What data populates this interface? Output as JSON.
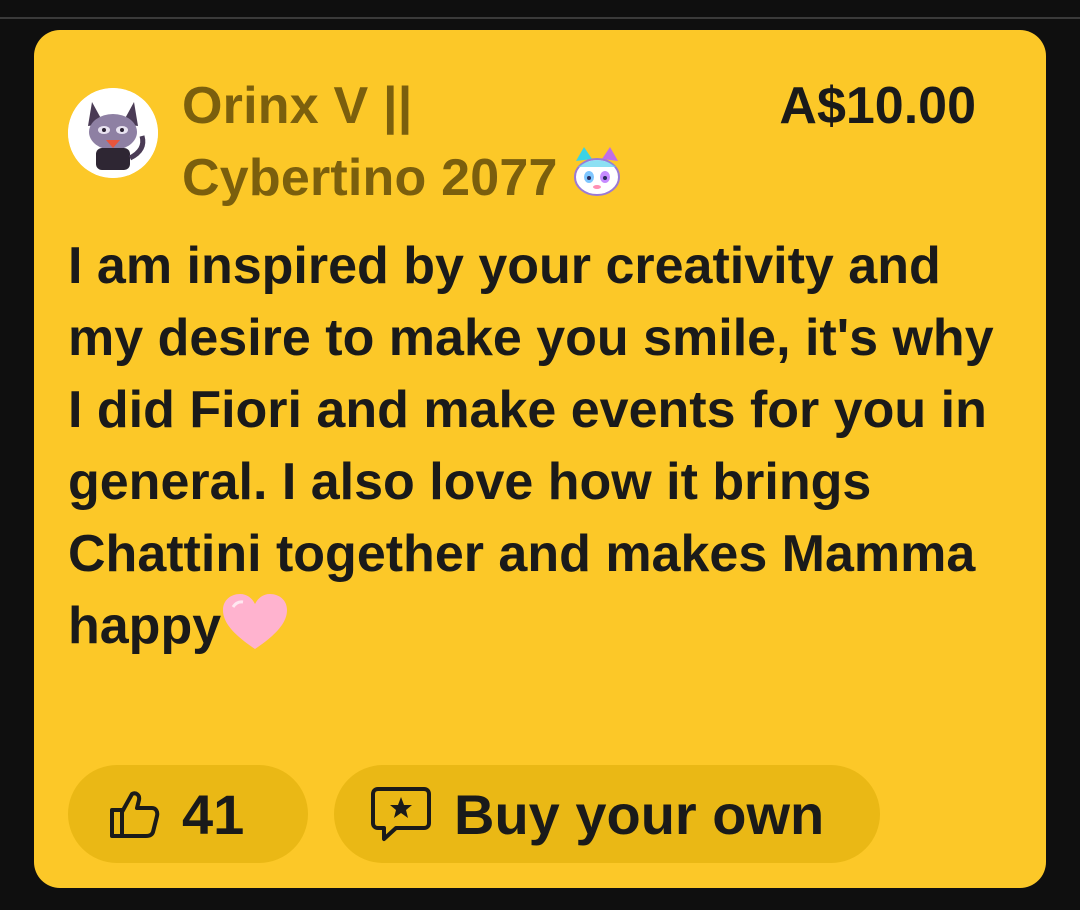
{
  "comment": {
    "author_line1": "Orinx V ||",
    "author_line2": "Cybertino 2077",
    "author_badge_icon": "cat-emote-icon",
    "avatar_icon": "purple-cat-avatar-icon",
    "amount": "A$10.00",
    "message": "I am inspired by your creativity and my desire to make you smile, it's why I did Fiori and make events for you in general. I also love how it brings Chattini together and makes Mamma happy",
    "message_emoji": "pink-heart-icon"
  },
  "actions": {
    "like_icon": "thumbs-up-icon",
    "like_count": "41",
    "buy_icon": "chat-star-icon",
    "buy_label": "Buy your own"
  },
  "colors": {
    "background": "#0f0f0f",
    "card": "#fcc828",
    "pill": "#eab815",
    "author_text": "#7b5f0d",
    "primary_text": "#1a1a1a",
    "heart": "#ffb3cf"
  }
}
